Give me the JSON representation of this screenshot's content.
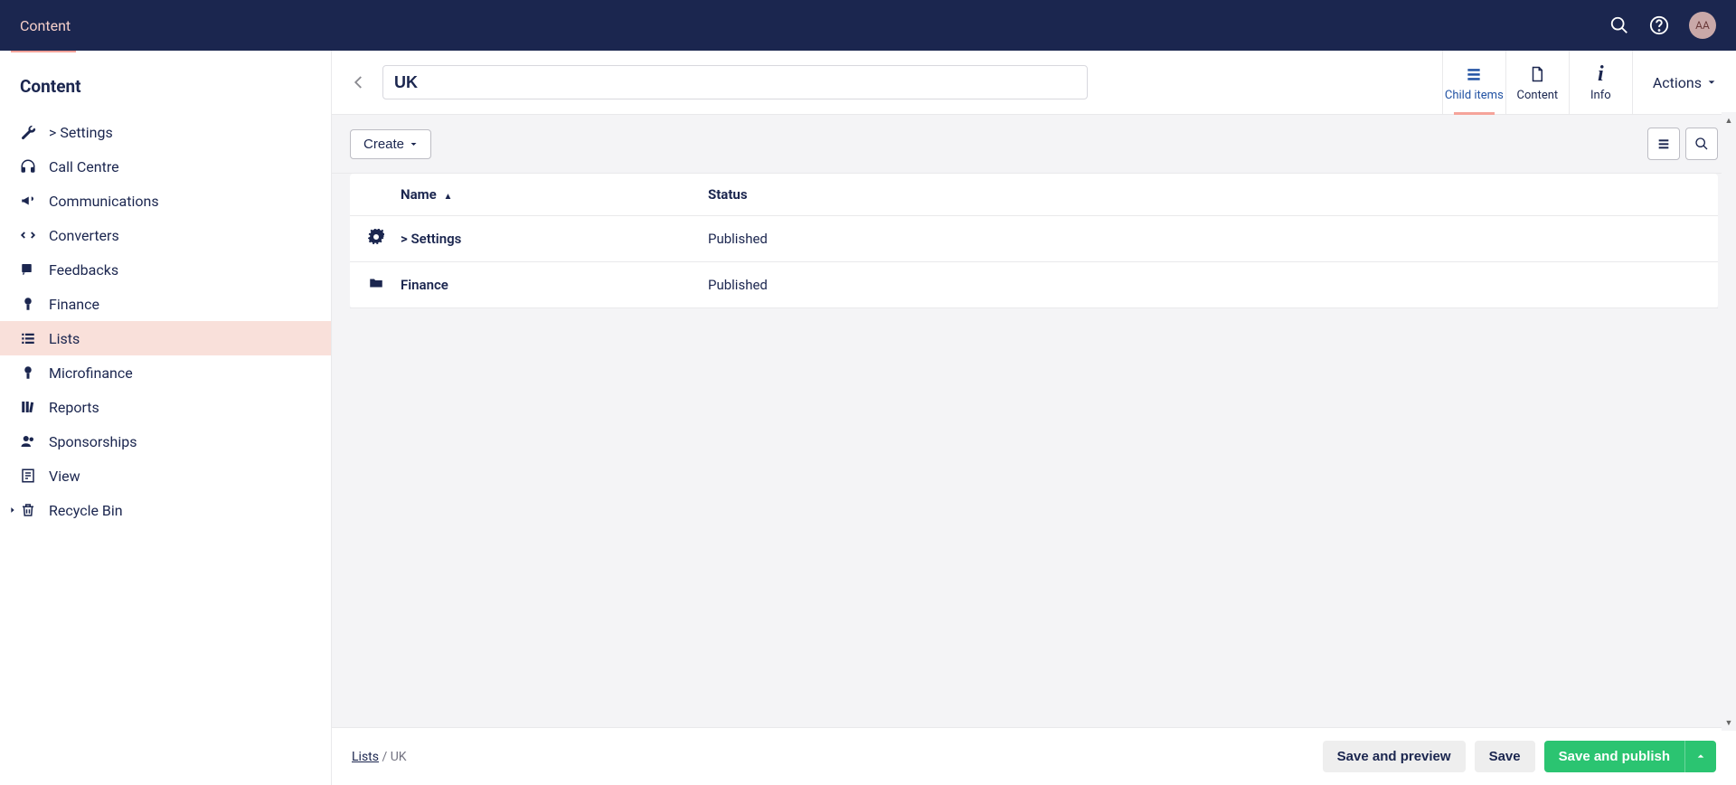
{
  "topbar": {
    "title": "Content",
    "avatar": "AA"
  },
  "sidebar": {
    "header": "Content",
    "items": [
      {
        "label": "> Settings",
        "icon": "wrench"
      },
      {
        "label": "Call Centre",
        "icon": "headphones"
      },
      {
        "label": "Communications",
        "icon": "megaphone"
      },
      {
        "label": "Converters",
        "icon": "converters"
      },
      {
        "label": "Feedbacks",
        "icon": "feedback"
      },
      {
        "label": "Finance",
        "icon": "finance"
      },
      {
        "label": "Lists",
        "icon": "list",
        "active": true
      },
      {
        "label": "Microfinance",
        "icon": "finance"
      },
      {
        "label": "Reports",
        "icon": "books"
      },
      {
        "label": "Sponsorships",
        "icon": "users"
      },
      {
        "label": "View",
        "icon": "article"
      },
      {
        "label": "Recycle Bin",
        "icon": "trash",
        "hasCaret": true
      }
    ]
  },
  "header": {
    "title_value": "UK",
    "tabs": [
      {
        "label": "Child items",
        "icon": "list",
        "active": true
      },
      {
        "label": "Content",
        "icon": "file"
      },
      {
        "label": "Info",
        "icon": "info"
      }
    ],
    "actions_label": "Actions"
  },
  "toolbar": {
    "create_label": "Create"
  },
  "table": {
    "columns": {
      "name": "Name",
      "status": "Status"
    },
    "rows": [
      {
        "name": "> Settings",
        "status": "Published",
        "icon": "gear"
      },
      {
        "name": "Finance",
        "status": "Published",
        "icon": "folder"
      }
    ]
  },
  "breadcrumb": {
    "parent": "Lists",
    "current": "UK"
  },
  "footer": {
    "save_preview": "Save and preview",
    "save": "Save",
    "save_publish": "Save and publish"
  }
}
